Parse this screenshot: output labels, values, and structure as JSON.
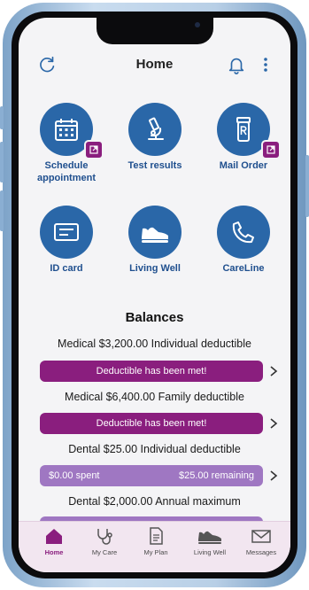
{
  "header": {
    "title": "Home"
  },
  "tiles": [
    {
      "label": "Schedule appointment",
      "icon": "calendar-icon"
    },
    {
      "label": "Test results",
      "icon": "microscope-icon"
    },
    {
      "label": "Mail Order",
      "icon": "prescription-bottle-icon"
    },
    {
      "label": "ID card",
      "icon": "id-card-icon"
    },
    {
      "label": "Living Well",
      "icon": "sneaker-icon"
    },
    {
      "label": "CareLine",
      "icon": "phone-icon"
    }
  ],
  "balances": {
    "title": "Balances",
    "items": [
      {
        "text": "Medical $3,200.00 Individual deductible",
        "status": "Deductible has been met!"
      },
      {
        "text": "Medical $6,400.00 Family deductible",
        "status": "Deductible has been met!"
      },
      {
        "text": "Dental $25.00 Individual deductible",
        "spent": "$0.00 spent",
        "remaining": "$25.00 remaining"
      },
      {
        "text": "Dental $2,000.00 Annual maximum"
      }
    ]
  },
  "tabs": [
    {
      "label": "Home",
      "icon": "home-icon"
    },
    {
      "label": "My Care",
      "icon": "stethoscope-icon"
    },
    {
      "label": "My Plan",
      "icon": "document-icon"
    },
    {
      "label": "Living Well",
      "icon": "sneaker-icon"
    },
    {
      "label": "Messages",
      "icon": "envelope-icon"
    }
  ],
  "colors": {
    "accent": "#8a1e7e",
    "primary": "#2a67a8",
    "spent_bar": "#9f77c2",
    "label": "#1f4f8e"
  }
}
